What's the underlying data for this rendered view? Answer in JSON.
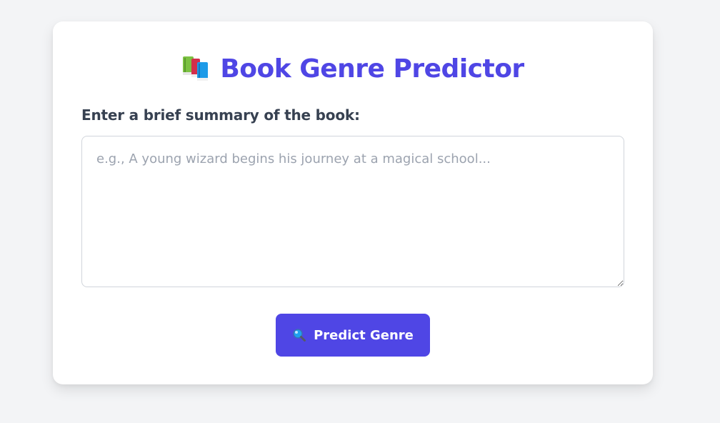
{
  "header": {
    "icon": "books-icon",
    "title": "Book Genre Predictor",
    "title_color": "#4f46e5"
  },
  "form": {
    "label": "Enter a brief summary of the book:",
    "summary_value": "",
    "summary_placeholder": "e.g., A young wizard begins his journey at a magical school...",
    "submit_icon": "magnifier-icon",
    "submit_label": "Predict Genre",
    "button_color": "#4f46e5"
  }
}
